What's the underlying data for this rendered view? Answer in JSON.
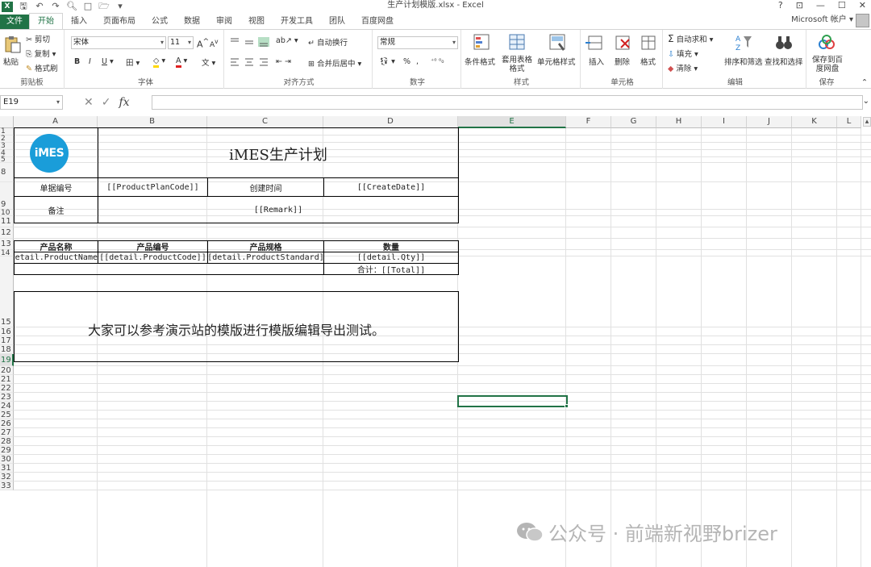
{
  "window": {
    "title": "生产计划模版.xlsx - Excel",
    "controls": [
      "?",
      "⊡",
      "—",
      "☐",
      "✕"
    ],
    "account": "Microsoft 帐户 ▾"
  },
  "qat": {
    "logo": "X",
    "save": "🖫",
    "undo": "↶",
    "redo": "↷",
    "items": [
      "□",
      "🗁"
    ]
  },
  "tabs": [
    "文件",
    "开始",
    "插入",
    "页面布局",
    "公式",
    "数据",
    "审阅",
    "视图",
    "开发工具",
    "团队",
    "百度网盘"
  ],
  "active_tab": "开始",
  "ribbon": {
    "clipboard": {
      "label": "剪贴板",
      "paste": "粘贴",
      "cut": "剪切",
      "copy": "复制",
      "format_painter": "格式刷"
    },
    "font": {
      "label": "字体",
      "name": "宋体",
      "size": "11",
      "grow": "A",
      "shrink": "A",
      "bold": "B",
      "italic": "I",
      "underline": "U",
      "border": "田",
      "fill": "◇",
      "color": "A",
      "phonetic": "文"
    },
    "alignment": {
      "label": "对齐方式",
      "wrap": "自动换行",
      "merge": "合并后居中"
    },
    "number": {
      "label": "数字",
      "format": "常规",
      "percent": "%",
      "comma": ","
    },
    "styles": {
      "label": "样式",
      "conditional": "条件格式",
      "table": "套用表格格式",
      "cell_styles": "单元格样式"
    },
    "cells": {
      "label": "单元格",
      "insert": "插入",
      "delete": "删除",
      "format": "格式"
    },
    "editing": {
      "label": "编辑",
      "autosum": "自动求和",
      "fill": "填充",
      "clear": "清除",
      "sort": "排序和筛选",
      "find": "查找和选择"
    },
    "save": {
      "label": "保存",
      "save_to": "保存到百度网盘"
    }
  },
  "formula_bar": {
    "name_box": "E19",
    "cancel": "✕",
    "enter": "✓",
    "fx": "fx",
    "content": ""
  },
  "columns": [
    "A",
    "B",
    "C",
    "D",
    "E",
    "F",
    "G",
    "H",
    "I",
    "J",
    "K",
    "L"
  ],
  "selected_column": "E",
  "rows": [
    "1",
    "2",
    "3",
    "4",
    "5",
    "8",
    "9",
    "10",
    "11",
    "12",
    "13",
    "14",
    "15",
    "16",
    "17",
    "18",
    "19",
    "20",
    "21",
    "22",
    "23",
    "24",
    "25",
    "26",
    "27",
    "28",
    "29",
    "30",
    "31",
    "32",
    "33"
  ],
  "selected_row": "19",
  "sheet": {
    "logo_text": "iMES",
    "title": "iMES生产计划",
    "doc_no_label": "单据编号",
    "doc_no_value": "[[ProductPlanCode]]",
    "created_label": "创建时间",
    "created_value": "[[CreateDate]]",
    "remark_label": "备注",
    "remark_value": "[[Remark]]",
    "table_headers": [
      "产品名称",
      "产品编号",
      "产品规格",
      "数量"
    ],
    "table_row": [
      "detail.ProductName",
      "[[detail.ProductCode]]",
      "[detail.ProductStandard]",
      "[[detail.Qty]]"
    ],
    "total": "合计：[[Total]]",
    "note": "大家可以参考演示站的模版进行模版编辑导出测试。"
  },
  "watermark": "公众号 · 前端新视野brizer"
}
